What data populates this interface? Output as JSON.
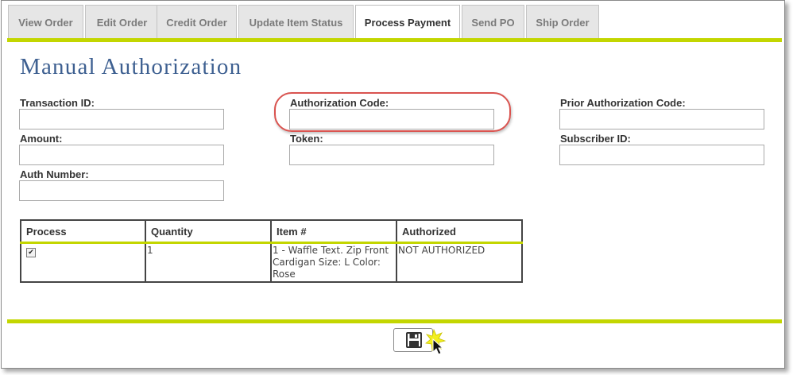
{
  "tabs": [
    {
      "label": "View Order"
    },
    {
      "label": "Edit Order"
    },
    {
      "label": "Credit Order"
    },
    {
      "label": "Update Item Status"
    },
    {
      "label": "Process Payment",
      "active": true
    },
    {
      "label": "Send PO"
    },
    {
      "label": "Ship Order"
    }
  ],
  "page_title": "Manual Authorization",
  "fields": {
    "transaction_id": {
      "label": "Transaction ID:",
      "value": ""
    },
    "authorization_code": {
      "label": "Authorization Code:",
      "value": ""
    },
    "prior_authorization_code": {
      "label": "Prior Authorization Code:",
      "value": ""
    },
    "amount": {
      "label": "Amount:",
      "value": ""
    },
    "token": {
      "label": "Token:",
      "value": ""
    },
    "subscriber_id": {
      "label": "Subscriber ID:",
      "value": ""
    },
    "auth_number": {
      "label": "Auth Number:",
      "value": ""
    }
  },
  "items_table": {
    "headers": [
      "Process",
      "Quantity",
      "Item #",
      "Authorized"
    ],
    "rows": [
      {
        "process_checked": true,
        "quantity": "1",
        "item": "1 - Waffle Text. Zip Front Cardigan Size: L Color: Rose",
        "authorized": "NOT AUTHORIZED"
      }
    ]
  },
  "save_button": {
    "icon": "floppy-disk-icon"
  },
  "colors": {
    "accent_bar": "#c3d600",
    "title": "#3e6091",
    "highlight_circle": "#d9534f"
  }
}
